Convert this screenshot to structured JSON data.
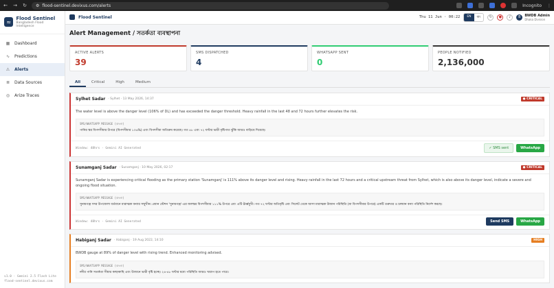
{
  "browser": {
    "url": "flood-sentinel.devixus.com/alerts",
    "incognito_label": "Incognito"
  },
  "sidebar": {
    "app_name": "Flood Sentinel",
    "app_subtitle": "Bangladesh Flood Intelligence",
    "items": [
      {
        "label": "Dashboard",
        "icon": "grid-icon"
      },
      {
        "label": "Predictions",
        "icon": "trend-icon"
      },
      {
        "label": "Alerts",
        "icon": "bell-icon",
        "active": true
      },
      {
        "label": "Data Sources",
        "icon": "database-icon"
      },
      {
        "label": "Arize Traces",
        "icon": "trace-icon"
      }
    ],
    "footer_line1": "v1.0 · Gemini 2.5 Flash Lite",
    "footer_line2": "flood-sentinel.devixus.com"
  },
  "topbar": {
    "title": "Flood Sentinel",
    "clock": "Thu 11 Jun · 00:22",
    "lang_en": "EN",
    "lang_bn": "বাং",
    "user_name": "BWDB Admin",
    "user_role": "Dhaka Division",
    "user_initial": "B"
  },
  "page": {
    "title": "Alert Management / সতর্কতা ব্যবস্থাপনা"
  },
  "stats": [
    {
      "label": "Active Alerts",
      "value": "39",
      "color": "#c0392b"
    },
    {
      "label": "SMS Dispatched",
      "value": "4",
      "color": "#1e3a5f"
    },
    {
      "label": "WhatsApp Sent",
      "value": "0",
      "color": "#2ecc71"
    },
    {
      "label": "People Notified",
      "value": "2,136,000",
      "color": "#333333"
    }
  ],
  "tabs": [
    "All",
    "Critical",
    "High",
    "Medium"
  ],
  "alerts": [
    {
      "location": "Sylhet Sadar",
      "meta": "· Sylhet · 13 May 2026, 14:37",
      "severity": "● CRITICAL",
      "severity_color": "#c0392b",
      "description": "The water level is above the danger level (106% of DL) and has exceeded the danger threshold. Heavy rainfall in the last 48 and 72 hours further elevates the risk.",
      "message_header": "SMS/WHATSAPP MESSAGE (বাংলা)",
      "message_body": "পানির স্তর বিপদসীমার উপরে (বিপদসীমার ১০৬%) এবং বিপদসীমা অতিক্রম করেছে। গত ৪৮ এবং ৭২ ঘণ্টার ভারী বৃষ্টিপাত ঝুঁকি আরও বাড়িয়ে দিয়েছে।",
      "source": "Window: 48hrs · Gemini AI Generated",
      "sms_button": "✓ SMS sent",
      "sms_sent": true,
      "whatsapp_button": "WhatsApp"
    },
    {
      "location": "Sunamganj Sadar",
      "meta": "· Sunamganj · 10 May 2026, 02:17",
      "severity": "● CRITICAL",
      "severity_color": "#c0392b",
      "description": "Sunamganj Sadar is experiencing critical flooding as the primary station 'Sunamganj' is 111% above its danger level and rising. Heavy rainfall in the last 72 hours and a critical upstream threat from Sylhet, which is also above its danger level, indicate a severe and ongoing flood situation.",
      "message_header": "SMS/WHATSAPP MESSAGE (বাংলা)",
      "message_body": "সুনামগঞ্জ সদর উপজেলা বর্তমানে মারাত্মক বন্যার সম্মুখীন। প্রধান স্টেশন 'সুনামগঞ্জ'-এর জলস্তর বিপদসীমার ১১১% উপরে এবং এটি ঊর্ধ্বমুখী। গত ৭২ ঘণ্টার অতিবৃষ্টি এবং সিলেট থেকে আসা মারাত্মক উজান পরিস্থিতি (যা বিপদসীমার উপরে) একটি গুরুতর ও চলমান বন্যা পরিস্থিতি নির্দেশ করছে।",
      "source": "Window: 48hrs · Gemini AI Generated",
      "sms_button": "Send SMS",
      "sms_sent": false,
      "whatsapp_button": "WhatsApp"
    },
    {
      "location": "Habiganj Sadar",
      "meta": "· Habiganj · 19 Aug 2022, 14:10",
      "severity": "HIGH",
      "severity_color": "#e67e22",
      "description": "BWDB gauge at 89% of danger level with rising trend. Enhanced monitoring advised.",
      "message_header": "SMS/WHATSAPP MESSAGE (বাংলা)",
      "message_body": "নদীর পানি সতর্কতা সীমার কাছাকাছি এবং উজানে ভারী বৃষ্টি হচ্ছে। ২৪-৪৮ ঘণ্টার মধ্যে পরিস্থিতি আরও খারাপ হতে পারে।"
    }
  ]
}
